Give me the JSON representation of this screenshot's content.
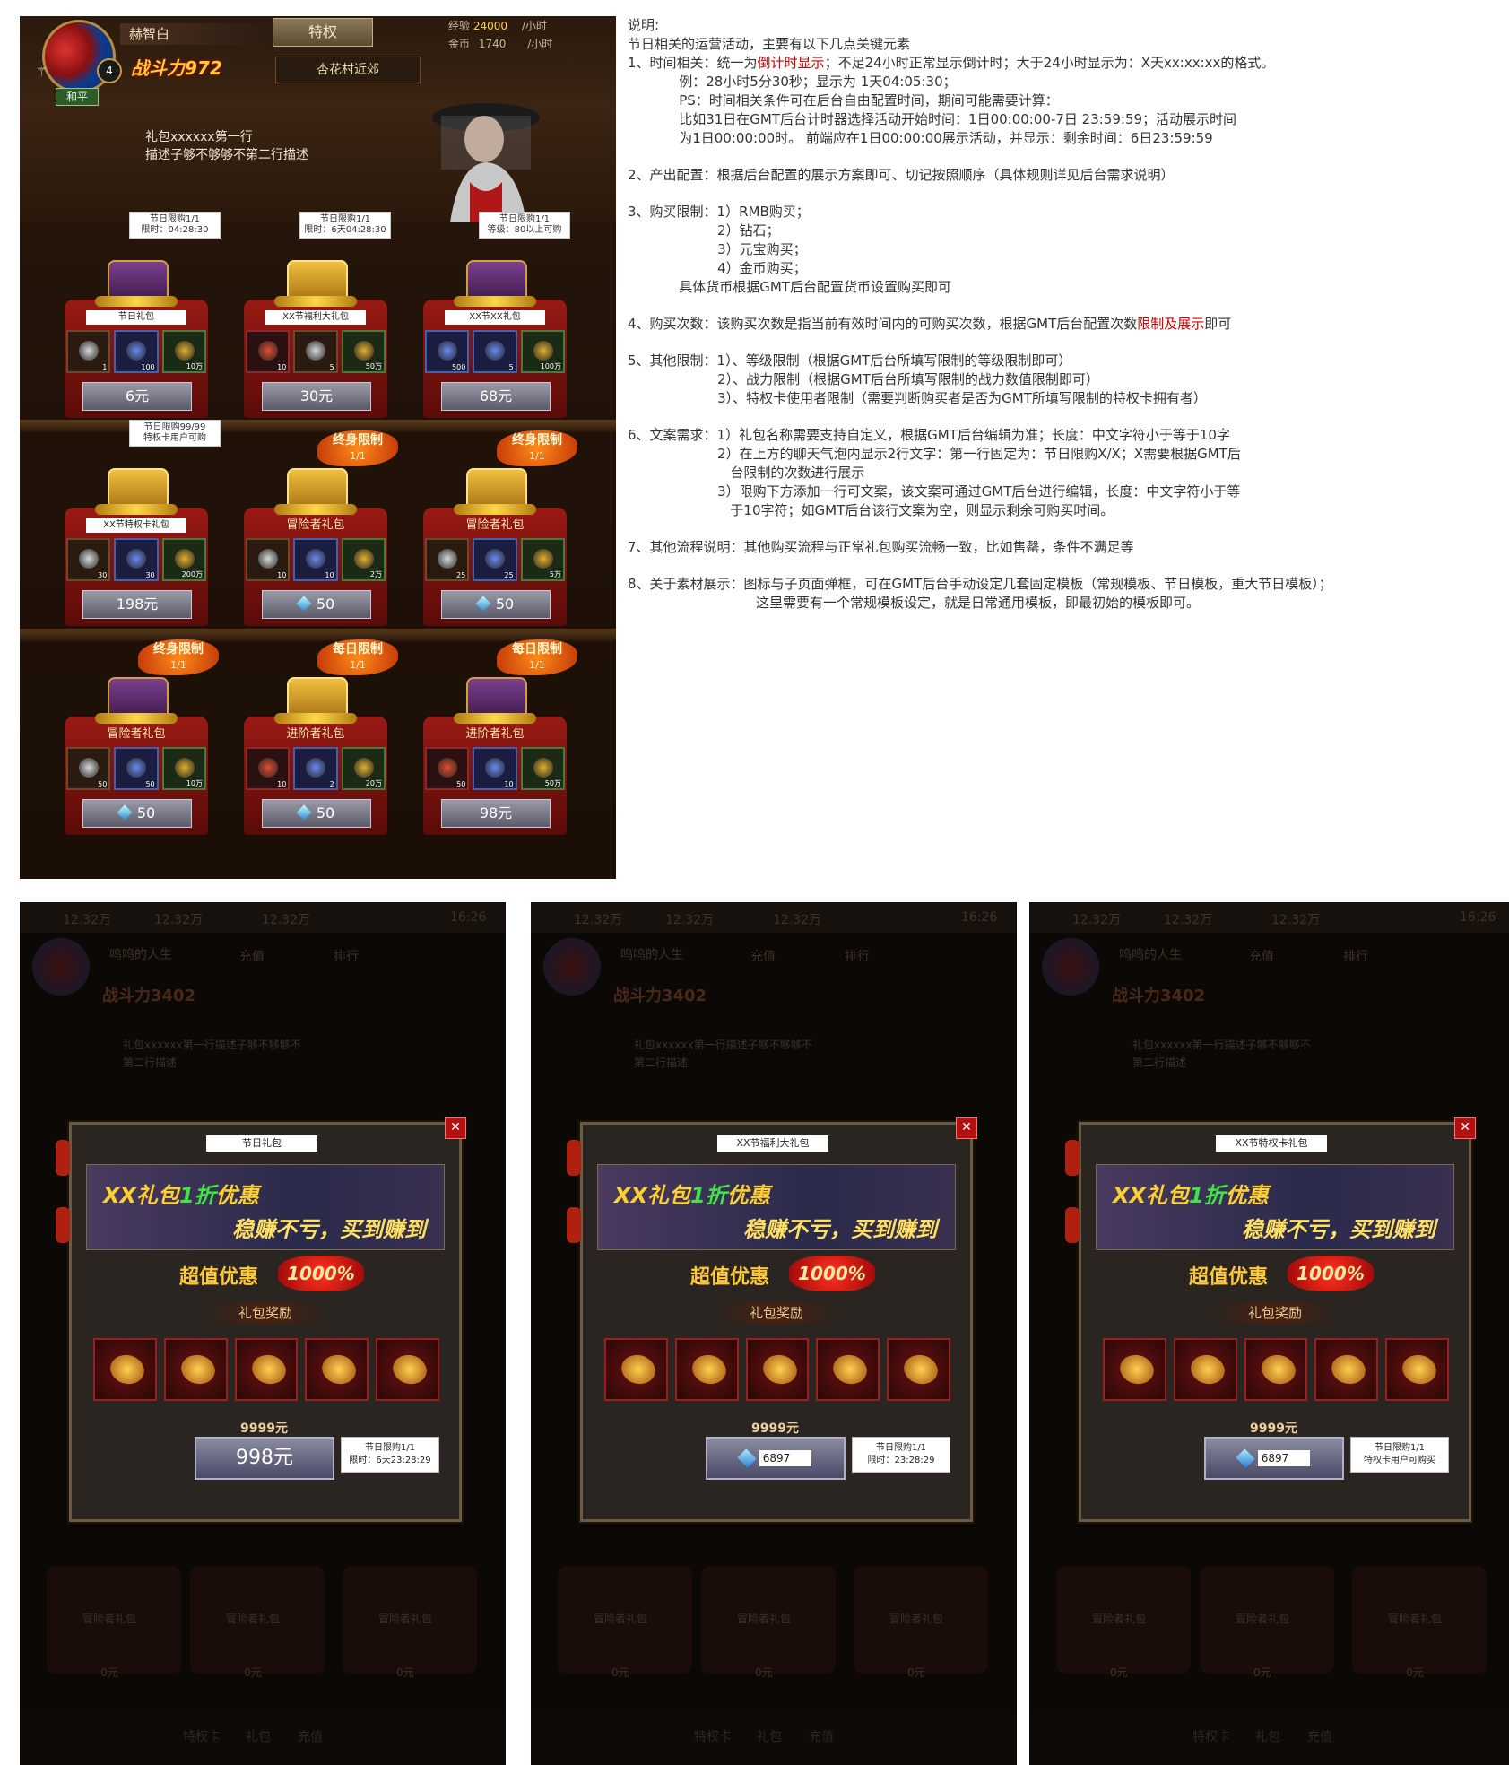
{
  "game": {
    "player_name": "赫智白",
    "level": "4",
    "privilege_button": "特权",
    "power_label": "战斗力",
    "power_value": "972",
    "location": "杏花村近郊",
    "peace_badge": "和平",
    "exp_label": "经验",
    "exp_value": "24000",
    "exp_unit": "/小时",
    "gold_label": "金币",
    "gold_value": "1740",
    "gold_unit": "/小时",
    "bubble_line1": "礼包xxxxxx第一行",
    "bubble_line2": "描述子够不够够不第二行描述",
    "gifts": [
      {
        "name": "节日礼包",
        "price": "6元",
        "tag1": "节日限购1/1",
        "tag2": "限时：04:28:30",
        "chest": "purple",
        "slots": [
          [
            "",
            "1"
          ],
          [
            "blue",
            "100"
          ],
          [
            "green",
            "10万"
          ]
        ]
      },
      {
        "name": "XX节福利大礼包",
        "price": "30元",
        "tag1": "节日限购1/1",
        "tag2": "限时：6天04:28:30",
        "chest": "gold",
        "slots": [
          [
            "red",
            "10"
          ],
          [
            "",
            "5"
          ],
          [
            "green",
            "50万"
          ]
        ]
      },
      {
        "name": "XX节XX礼包",
        "price": "68元",
        "tag1": "节日限购1/1",
        "tag2": "等级：80以上可购",
        "chest": "purple",
        "slots": [
          [
            "blue",
            "500"
          ],
          [
            "blue",
            "5"
          ],
          [
            "green",
            "100万"
          ]
        ]
      },
      {
        "name": "XX节特权卡礼包",
        "price": "198元",
        "tag1": "节日限购99/99",
        "tag2": "特权卡用户可购",
        "chest": "gold",
        "slots": [
          [
            "",
            "30"
          ],
          [
            "blue",
            "30"
          ],
          [
            "green",
            "200万"
          ]
        ]
      },
      {
        "name": "冒险者礼包",
        "price": "50",
        "limit": "终身限制",
        "limit_count": "1/1",
        "chest": "gold",
        "slots": [
          [
            "",
            "10"
          ],
          [
            "blue",
            "10"
          ],
          [
            "green",
            "2万"
          ]
        ]
      },
      {
        "name": "冒险者礼包",
        "price": "50",
        "limit": "终身限制",
        "limit_count": "1/1",
        "chest": "gold",
        "slots": [
          [
            "",
            "25"
          ],
          [
            "blue",
            "25"
          ],
          [
            "green",
            "5万"
          ]
        ]
      },
      {
        "name": "冒险者礼包",
        "price": "50",
        "limit": "终身限制",
        "limit_count": "1/1",
        "chest": "purple",
        "slots": [
          [
            "",
            "50"
          ],
          [
            "blue",
            "50"
          ],
          [
            "green",
            "10万"
          ]
        ]
      },
      {
        "name": "进阶者礼包",
        "price": "50",
        "limit": "每日限制",
        "limit_count": "1/1",
        "chest": "gold",
        "slots": [
          [
            "red",
            "10"
          ],
          [
            "blue",
            "2"
          ],
          [
            "green",
            "20万"
          ]
        ]
      },
      {
        "name": "进阶者礼包",
        "price": "98元",
        "limit": "每日限制",
        "limit_count": "1/1",
        "chest": "purple",
        "slots": [
          [
            "red",
            "50"
          ],
          [
            "blue",
            "10"
          ],
          [
            "green",
            "50万"
          ]
        ]
      }
    ]
  },
  "desc": {
    "title": "说明:",
    "intro": "节日相关的运营活动，主要有以下几点关键元素",
    "s1_a": "1、时间相关：统一为",
    "s1_red": "倒计时显示",
    "s1_b": "；不足24小时正常显示倒计时；大于24小时显示为：X天xx:xx:xx的格式。",
    "s1_l2": "            例：28小时5分30秒；显示为 1天04:05:30；",
    "s1_l3": "            PS：时间相关条件可在后台自由配置时间，期间可能需要计算：",
    "s1_l4": "            比如31日在GMT后台计时器选择活动开始时间：1日00:00:00-7日 23:59:59；活动展示时间",
    "s1_l5": "            为1日00:00:00时。 前端应在1日00:00:00展示活动，并显示：剩余时间：6日23:59:59",
    "s2": "2、产出配置：根据后台配置的展示方案即可、切记按照顺序（具体规则详见后台需求说明）",
    "s3_l1": "3、购买限制：1）RMB购买；",
    "s3_l2": "                     2）钻石；",
    "s3_l3": "                     3）元宝购买；",
    "s3_l4": "                     4）金币购买；",
    "s3_l5": "            具体货币根据GMT后台配置货币设置购买即可",
    "s4_a": "4、购买次数：该购买次数是指当前有效时间内的可购买次数，根据GMT后台配置次数",
    "s4_red": "限制及展示",
    "s4_b": "即可",
    "s5_l1": "5、其他限制：1）、等级限制（根据GMT后台所填写限制的等级限制即可）",
    "s5_l2": "                     2）、战力限制（根据GMT后台所填写限制的战力数值限制即可）",
    "s5_l3": "                     3）、特权卡使用者限制（需要判断购买者是否为GMT所填写限制的特权卡拥有者）",
    "s6_l1": "6、文案需求：1）礼包名称需要支持自定义，根据GMT后台编辑为准；长度：中文字符小于等于10字",
    "s6_l2": "                     2）在上方的聊天气泡内显示2行文字：第一行固定为：节日限购X/X；X需要根据GMT后",
    "s6_l3": "                        台限制的次数进行展示",
    "s6_l4": "                     3）限购下方添加一行可文案，该文案可通过GMT后台进行编辑，长度：中文字符小于等",
    "s6_l5": "                        于10字符；如GMT后台该行文案为空，则显示剩余可购买时间。",
    "s7": "7、其他流程说明：其他购买流程与正常礼包购买流畅一致，比如售罄，条件不满足等",
    "s8_l1": "8、关于素材展示：图标与子页面弹框，可在GMT后台手动设定几套固定模板（常规模板、节日模板，重大节日模板）；",
    "s8_l2": "                              这里需要有一个常规模板设定，就是日常通用模板，即最初始的模板即可。"
  },
  "popups": [
    {
      "title": "节日礼包",
      "price": "998元",
      "tag1": "节日限购1/1",
      "tag2": "限时：6天23:28:29",
      "diamond": false
    },
    {
      "title": "XX节福利大礼包",
      "price": "6897",
      "tag1": "节日限购1/1",
      "tag2": "限时：23:28:29",
      "diamond": true
    },
    {
      "title": "XX节特权卡礼包",
      "price": "6897",
      "tag1": "节日限购1/1",
      "tag2": "特权卡用户可购买",
      "diamond": true
    }
  ],
  "popup_common": {
    "banner1_a": "XX礼包",
    "banner1_b": "1折",
    "banner1_c": "优惠",
    "banner2": "稳赚不亏，买到赚到",
    "value_label": "超值优惠",
    "value_percent": "1000%",
    "reward_label": "礼包奖励",
    "original_price": "9999元",
    "bg_top1": "12.32万",
    "bg_top2": "12.32万",
    "bg_top3": "12.32万",
    "bg_time": "16:26",
    "bg_name": "呜呜的人生",
    "bg_tab1": "充值",
    "bg_tab2": "排行",
    "bg_power": "战斗力3402",
    "bg_bubble1": "礼包xxxxxx第一行描述子够不够够不",
    "bg_bubble2": "第二行描述",
    "bg_gift": "冒险者礼包",
    "bg_price": "0元",
    "bg_bot1": "特权卡",
    "bg_bot2": "礼包",
    "bg_bot3": "充值"
  }
}
